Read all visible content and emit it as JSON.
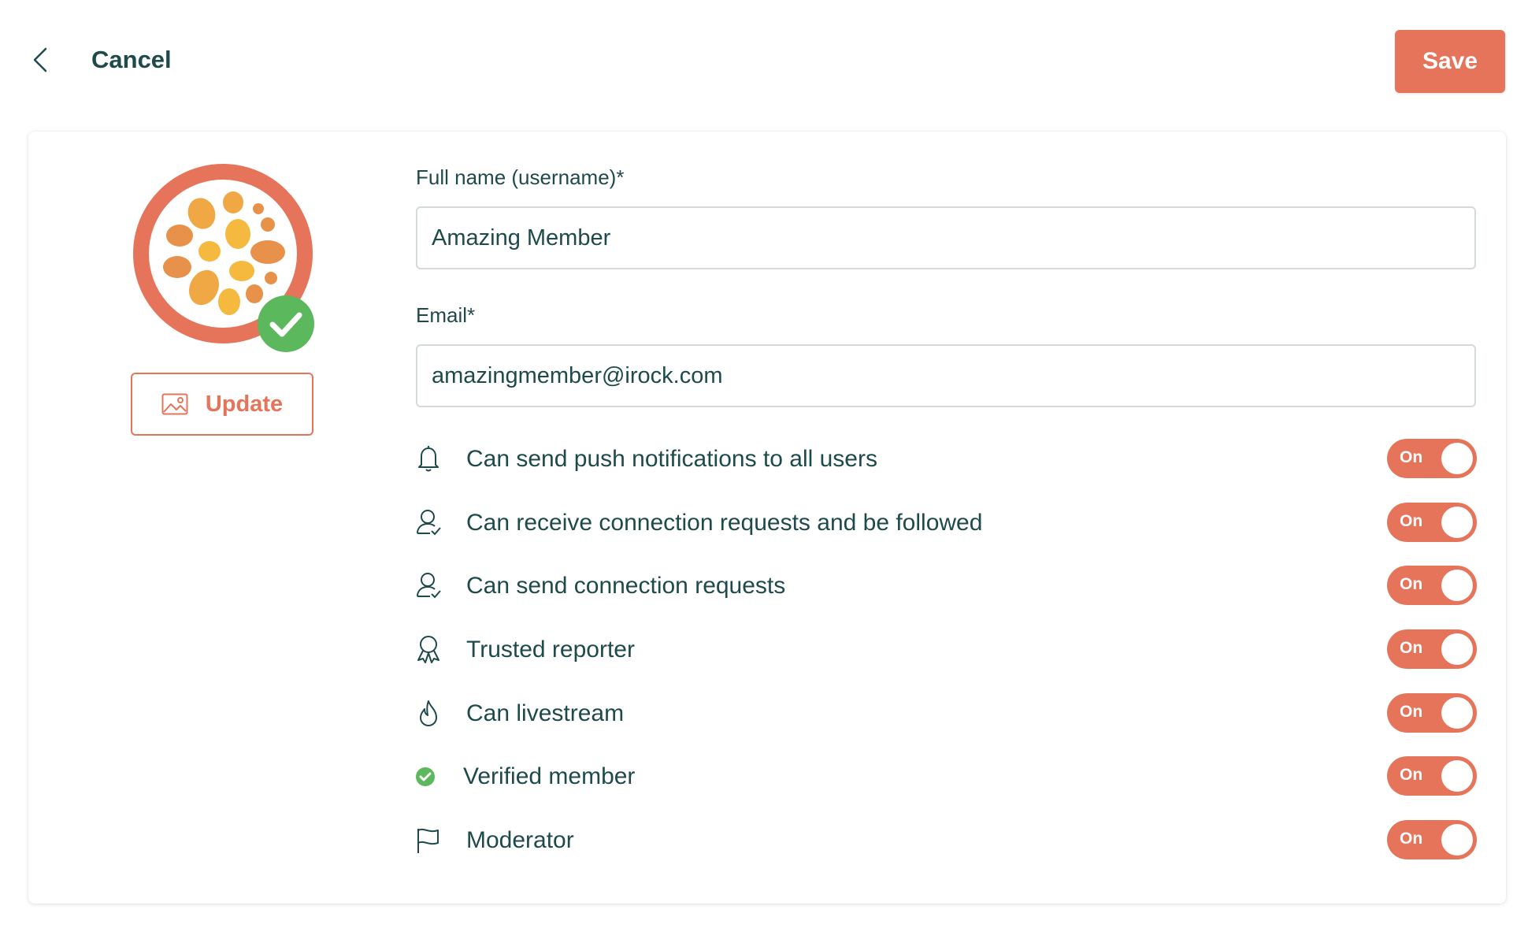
{
  "header": {
    "back_icon": "chevron-left-icon",
    "cancel_label": "Cancel",
    "save_label": "Save"
  },
  "profile": {
    "update_label": "Update",
    "update_icon": "image-icon",
    "verified_badge_icon": "check-circle-icon"
  },
  "form": {
    "full_name": {
      "label": "Full name (username)*",
      "value": "Amazing Member"
    },
    "email": {
      "label": "Email*",
      "value": "amazingmember@irock.com"
    }
  },
  "permissions": [
    {
      "icon": "bell-icon",
      "label": "Can send push notifications to all users",
      "toggle": "On"
    },
    {
      "icon": "user-check-icon",
      "label": "Can receive connection requests and be followed",
      "toggle": "On"
    },
    {
      "icon": "user-check-icon",
      "label": "Can send connection requests",
      "toggle": "On"
    },
    {
      "icon": "award-icon",
      "label": "Trusted reporter",
      "toggle": "On"
    },
    {
      "icon": "flame-icon",
      "label": "Can livestream",
      "toggle": "On"
    },
    {
      "icon": "check-circle-icon",
      "label": "Verified member",
      "toggle": "On"
    },
    {
      "icon": "flag-icon",
      "label": "Moderator",
      "toggle": "On"
    }
  ],
  "colors": {
    "accent": "#e5745b",
    "text": "#1f4a4c",
    "verified_green": "#5cb85c",
    "input_border": "#d4d9d9"
  }
}
